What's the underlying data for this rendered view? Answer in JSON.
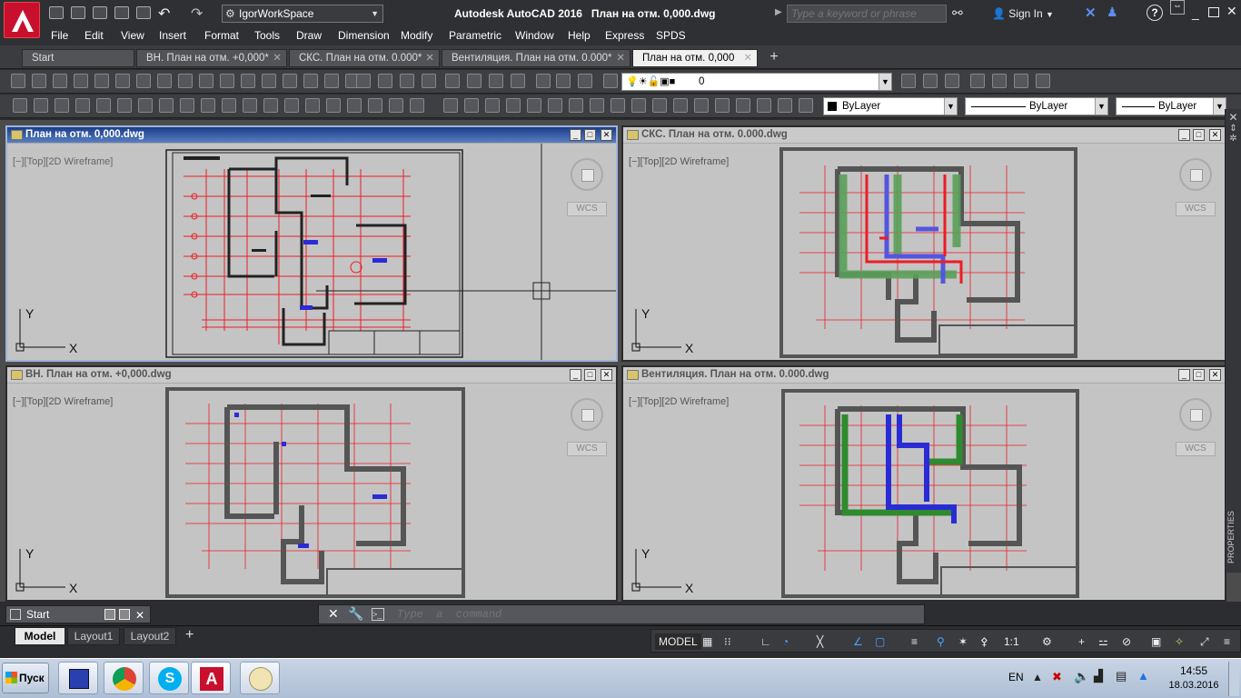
{
  "app": {
    "workspace": "IgorWorkSpace",
    "title_app": "Autodesk AutoCAD 2016",
    "title_file": "План на отм. 0,000.dwg",
    "search_placeholder": "Type a keyword or phrase",
    "sign_in": "Sign In"
  },
  "menu": [
    "File",
    "Edit",
    "View",
    "Insert",
    "Format",
    "Tools",
    "Draw",
    "Dimension",
    "Modify",
    "Parametric",
    "Window",
    "Help",
    "Express",
    "SPDS"
  ],
  "file_tabs": [
    {
      "label": "Start",
      "active": false
    },
    {
      "label": "ВН. План на отм. +0,000*",
      "active": false
    },
    {
      "label": "СКС. План на отм. 0.000*",
      "active": false
    },
    {
      "label": "Вентиляция. План на отм. 0.000*",
      "active": false
    },
    {
      "label": "План на отм. 0,000",
      "active": true
    }
  ],
  "properties": {
    "layer": "0",
    "color": "ByLayer",
    "linetype": "ByLayer",
    "lineweight": "ByLayer"
  },
  "viewports": [
    {
      "title": "План на отм. 0,000.dwg",
      "label": "[−][Top][2D Wireframe]",
      "wcs": "WCS",
      "active": true
    },
    {
      "title": "СКС. План на отм. 0.000.dwg",
      "label": "[−][Top][2D Wireframe]",
      "wcs": "WCS",
      "active": false
    },
    {
      "title": "ВН. План на отм. +0,000.dwg",
      "label": "[−][Top][2D Wireframe]",
      "wcs": "WCS",
      "active": false
    },
    {
      "title": "Вентиляция. План на отм. 0.000.dwg",
      "label": "[−][Top][2D Wireframe]",
      "wcs": "WCS",
      "active": false
    }
  ],
  "ucs": {
    "x": "X",
    "y": "Y"
  },
  "start_window": "Start",
  "command": {
    "placeholder": "Type  a  command"
  },
  "layout_tabs": [
    {
      "label": "Model",
      "active": true
    },
    {
      "label": "Layout1",
      "active": false
    },
    {
      "label": "Layout2",
      "active": false
    }
  ],
  "status": {
    "model": "MODEL",
    "scale": "1:1"
  },
  "right_panel": "PROPERTIES",
  "taskbar": {
    "start": "Пуск",
    "lang": "EN",
    "time": "14:55",
    "date": "18.03.2016"
  },
  "colors": {
    "viewport_bg": "#c4c4c4",
    "plan_red": "#ee1c25",
    "plan_black": "#222222",
    "plan_wall_gray": "#555555",
    "duct_green": "#2f8a2f",
    "duct_blue": "#2b2bd6",
    "active_header": "#1b3d8a"
  }
}
